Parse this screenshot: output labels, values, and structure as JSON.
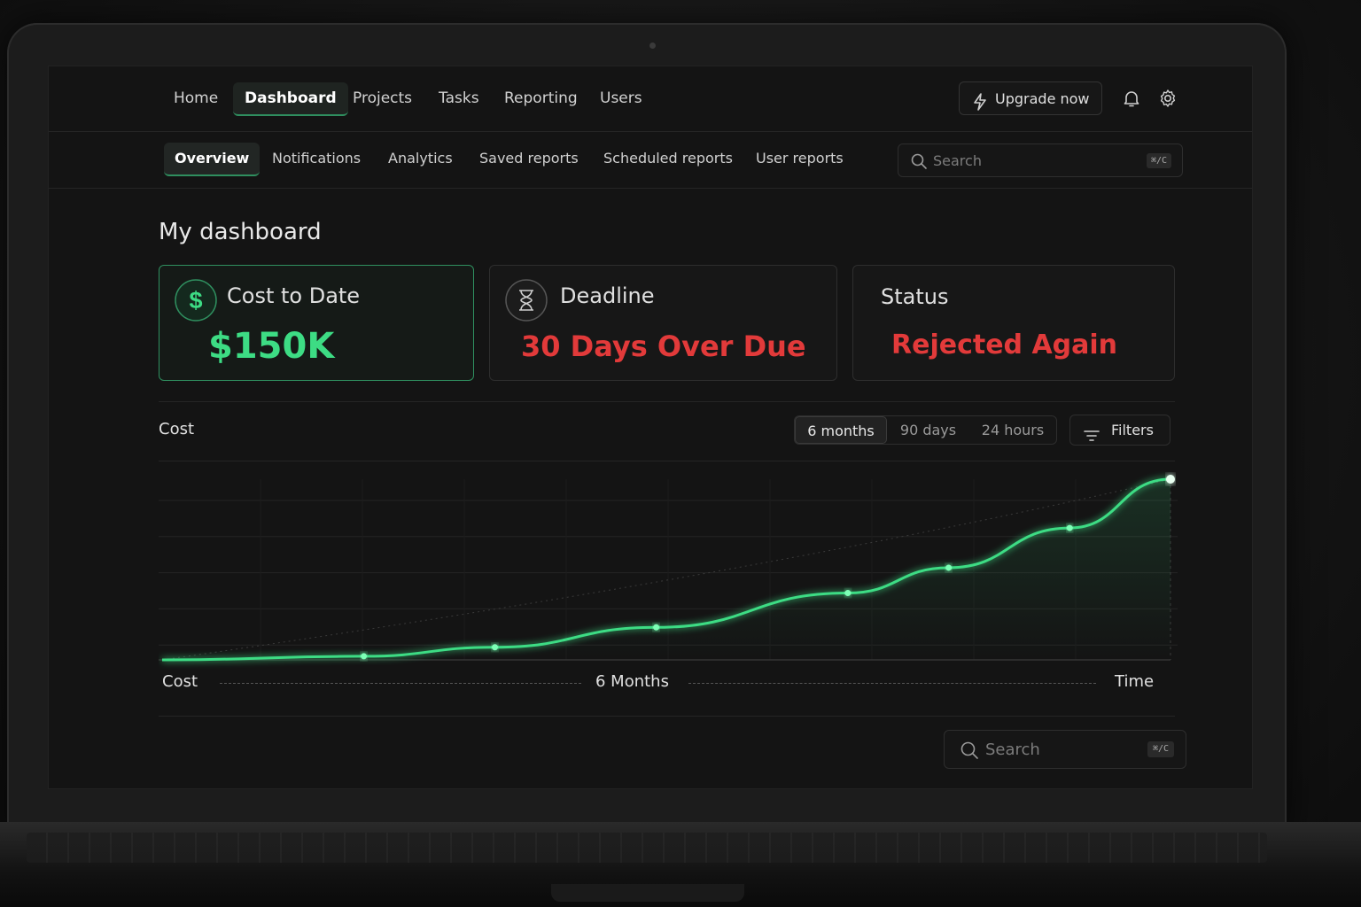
{
  "nav": {
    "items": [
      "Home",
      "Dashboard",
      "Projects",
      "Tasks",
      "Reporting",
      "Users"
    ],
    "active": "Dashboard",
    "upgrade_label": "Upgrade now"
  },
  "subnav": {
    "tabs": [
      "Overview",
      "Notifications",
      "Analytics",
      "Saved reports",
      "Scheduled reports",
      "User reports"
    ],
    "active": "Overview",
    "search_placeholder": "Search",
    "search_shortcut": "⌘/C"
  },
  "page_title": "My dashboard",
  "cards": {
    "cost": {
      "label": "Cost to Date",
      "value": "$150K",
      "icon": "dollar-icon"
    },
    "deadline": {
      "label": "Deadline",
      "value": "30 Days Over Due",
      "icon": "hourglass-icon"
    },
    "status": {
      "label": "Status",
      "value": "Rejected Again"
    }
  },
  "chart_section": {
    "label": "Cost",
    "ranges": [
      "6 months",
      "90 days",
      "24 hours"
    ],
    "active_range": "6 months",
    "filters_label": "Filters"
  },
  "chart_data": {
    "type": "line",
    "xlabel": "Time",
    "ylabel": "Cost",
    "x_annotation": "6 Months",
    "series": [
      {
        "x": [
          0,
          0.2,
          0.33,
          0.49,
          0.68,
          0.78,
          0.9,
          1.0
        ],
        "values": [
          0,
          2,
          7,
          18,
          37,
          51,
          73,
          100
        ]
      }
    ]
  },
  "bottom_search": {
    "placeholder": "Search",
    "shortcut": "⌘/C"
  },
  "colors": {
    "accent": "#3ddc84",
    "danger": "#e23a3a",
    "background": "#141414"
  }
}
